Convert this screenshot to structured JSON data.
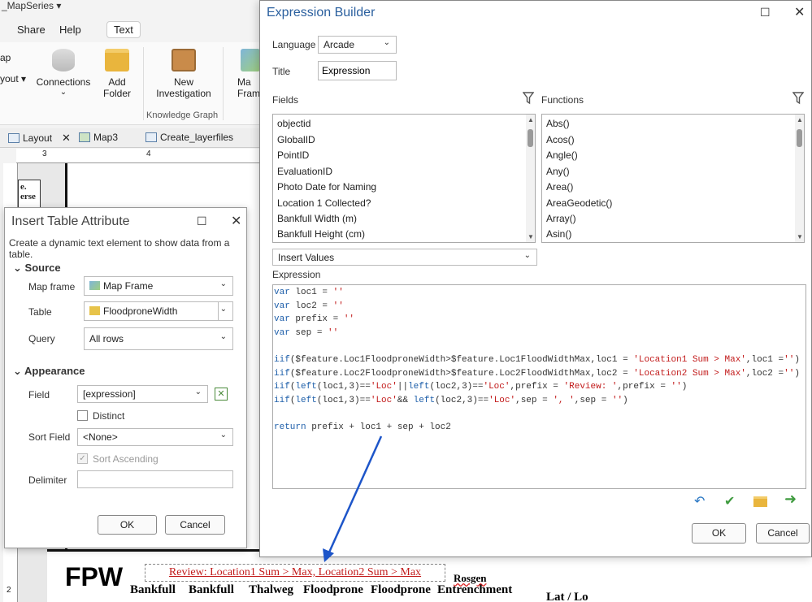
{
  "app": {
    "title_fragment": "_MapSeries ▾",
    "menu": [
      "Share",
      "Help"
    ],
    "active_tab": "Text"
  },
  "ribbon": {
    "frag_left_1": "ap",
    "frag_left_2": "yout ▾",
    "connections": "Connections",
    "add_folder": "Add\nFolder",
    "new_investigation": "New\nInvestigation",
    "map_frame_frag": "Ma\nFram",
    "group_label": "Knowledge Graph"
  },
  "doc_tabs": [
    "Layout",
    "Map3",
    "Create_layerfiles"
  ],
  "ruler": {
    "h": [
      "3",
      "4"
    ],
    "v": [
      "1",
      "2"
    ]
  },
  "layout_thumb": "e.\nerse",
  "insert_table_attribute": {
    "title": "Insert Table Attribute",
    "description": "Create a dynamic text element to show data from a table.",
    "source_header": "Source",
    "map_frame_label": "Map frame",
    "map_frame_value": "Map Frame",
    "table_label": "Table",
    "table_value": "FloodproneWidth",
    "query_label": "Query",
    "query_value": "All rows",
    "appearance_header": "Appearance",
    "field_label": "Field",
    "field_value": "[expression]",
    "distinct_label": "Distinct",
    "sort_field_label": "Sort Field",
    "sort_field_value": "<None>",
    "sort_ascending_label": "Sort Ascending",
    "delimiter_label": "Delimiter",
    "delimiter_value": "",
    "ok": "OK",
    "cancel": "Cancel"
  },
  "expression_builder": {
    "title": "Expression Builder",
    "language_label": "Language",
    "language_value": "Arcade",
    "title_label": "Title",
    "title_value": "Expression",
    "fields_label": "Fields",
    "functions_label": "Functions",
    "fields": [
      "objectid",
      "GlobalID",
      "PointID",
      "EvaluationID",
      "Photo Date for Naming",
      "Location 1 Collected?",
      "Bankfull Width (m)",
      "Bankfull Height (cm)"
    ],
    "functions": [
      "Abs()",
      "Acos()",
      "Angle()",
      "Any()",
      "Area()",
      "AreaGeodetic()",
      "Array()",
      "Asin()"
    ],
    "insert_values": "Insert Values",
    "expression_label": "Expression",
    "code_lines": [
      [
        [
          "kw",
          "var"
        ],
        [
          "t",
          " loc1 = "
        ],
        [
          "str",
          "''"
        ]
      ],
      [
        [
          "kw",
          "var"
        ],
        [
          "t",
          " loc2 = "
        ],
        [
          "str",
          "''"
        ]
      ],
      [
        [
          "kw",
          "var"
        ],
        [
          "t",
          " prefix = "
        ],
        [
          "str",
          "''"
        ]
      ],
      [
        [
          "kw",
          "var"
        ],
        [
          "t",
          " sep = "
        ],
        [
          "str",
          "''"
        ]
      ],
      [],
      [
        [
          "kw",
          "iif"
        ],
        [
          "t",
          "($feature.Loc1FloodproneWidth>$feature.Loc1FloodWidthMax,loc1 = "
        ],
        [
          "str",
          "'Location1 Sum > Max'"
        ],
        [
          "t",
          ",loc1 ="
        ],
        [
          "str",
          "''"
        ],
        [
          "t",
          ")"
        ]
      ],
      [
        [
          "kw",
          "iif"
        ],
        [
          "t",
          "($feature.Loc2FloodproneWidth>$feature.Loc2FloodWidthMax,loc2 = "
        ],
        [
          "str",
          "'Location2 Sum > Max'"
        ],
        [
          "t",
          ",loc2 ="
        ],
        [
          "str",
          "''"
        ],
        [
          "t",
          ")"
        ]
      ],
      [
        [
          "kw",
          "iif"
        ],
        [
          "t",
          "("
        ],
        [
          "kw",
          "left"
        ],
        [
          "t",
          "(loc1,3)=="
        ],
        [
          "str",
          "'Loc'"
        ],
        [
          "t",
          "||"
        ],
        [
          "kw",
          "left"
        ],
        [
          "t",
          "(loc2,3)=="
        ],
        [
          "str",
          "'Loc'"
        ],
        [
          "t",
          ",prefix = "
        ],
        [
          "str",
          "'Review: '"
        ],
        [
          "t",
          ",prefix = "
        ],
        [
          "str",
          "''"
        ],
        [
          "t",
          ")"
        ]
      ],
      [
        [
          "kw",
          "iif"
        ],
        [
          "t",
          "("
        ],
        [
          "kw",
          "left"
        ],
        [
          "t",
          "(loc1,3)=="
        ],
        [
          "str",
          "'Loc'"
        ],
        [
          "t",
          "&& "
        ],
        [
          "kw",
          "left"
        ],
        [
          "t",
          "(loc2,3)=="
        ],
        [
          "str",
          "'Loc'"
        ],
        [
          "t",
          ",sep = "
        ],
        [
          "str",
          "', '"
        ],
        [
          "t",
          ",sep = "
        ],
        [
          "str",
          "''"
        ],
        [
          "t",
          ")"
        ]
      ],
      [],
      [
        [
          "kw",
          "return"
        ],
        [
          "t",
          " prefix + loc1 + sep + loc2"
        ]
      ]
    ],
    "ok": "OK",
    "cancel": "Cancel"
  },
  "layout_table": {
    "fpw": "FPW",
    "dynamic_text": "Review: Location1 Sum > Max, Location2 Sum > Max",
    "headers": [
      "Bankfull",
      "Bankfull",
      "Thalweg",
      "Floodprone",
      "Floodprone",
      "Entrenchment"
    ],
    "rosgen": "Rosgen",
    "lat_frag": "Lat / Lo"
  },
  "colors": {
    "accent_blue": "#2a5f9e",
    "arrow": "#1d55c9",
    "string_red": "#c21b1b",
    "keyword_blue": "#1e5faa"
  }
}
